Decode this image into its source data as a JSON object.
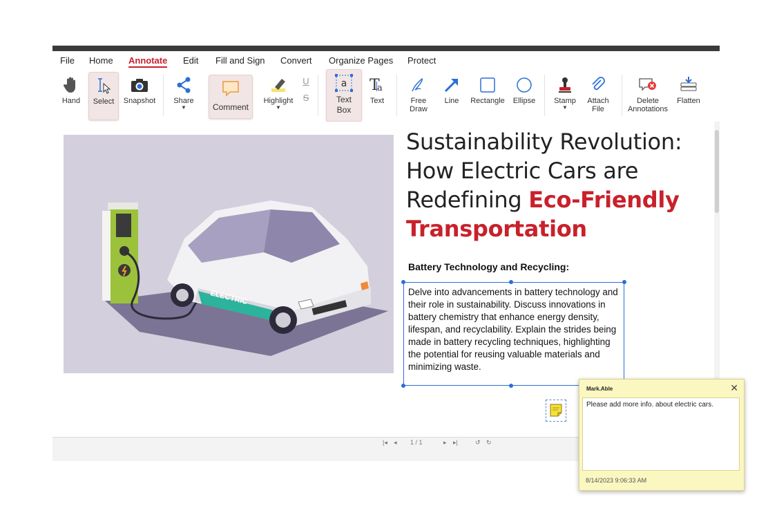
{
  "menu": {
    "items": [
      "File",
      "Home",
      "Annotate",
      "Edit",
      "Fill and Sign",
      "Convert",
      "Organize Pages",
      "Protect"
    ],
    "active": "Annotate"
  },
  "ribbon": {
    "hand": "Hand",
    "select": "Select",
    "snapshot": "Snapshot",
    "share": "Share",
    "comment": "Comment",
    "highlight": "Highlight",
    "text_box_1": "Text",
    "text_box_2": "Box",
    "text": "Text",
    "free_draw_1": "Free",
    "free_draw_2": "Draw",
    "line": "Line",
    "rectangle": "Rectangle",
    "ellipse": "Ellipse",
    "stamp": "Stamp",
    "attach_file_1": "Attach",
    "attach_file_2": "File",
    "delete_annotations_1": "Delete",
    "delete_annotations_2": "Annotations",
    "flatten": "Flatten"
  },
  "document": {
    "title_line1": "Sustainability Revolution:",
    "title_line2": "How Electric Cars are",
    "title_line3_plain": "Redefining ",
    "title_line3_highlight": "Eco-Friendly",
    "title_line4_highlight": "Transportation",
    "subheading": "Battery Technology and Recycling:",
    "body": "Delve into advancements in battery technology and their role in sustainability. Discuss innovations in battery chemistry that enhance energy density, lifespan, and recyclability. Explain the strides being made in battery recycling techniques, highlighting the potential for reusing valuable materials and minimizing waste.",
    "car_label": "ELECTRIC"
  },
  "status": {
    "page_indicator": "1 / 1"
  },
  "comment_popup": {
    "author": "Mark.Able",
    "text": "Please add more info. about electric cars.",
    "timestamp": "8/14/2023 9:06:33 AM"
  },
  "colors": {
    "accent": "#c8212b",
    "selection": "#2b6fd6",
    "note_bg": "#fbf7c1"
  }
}
